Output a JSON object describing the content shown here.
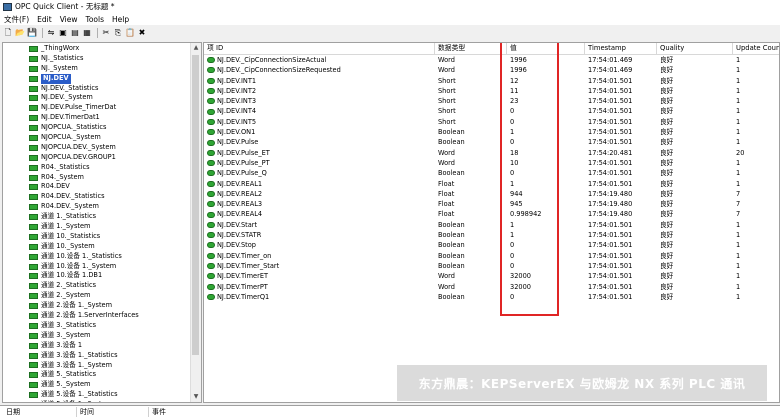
{
  "window": {
    "title": "OPC Quick Client - 无标题 *"
  },
  "menu": [
    "文件(F)",
    "Edit",
    "View",
    "Tools",
    "Help"
  ],
  "toolbar": {
    "icons": [
      "new-file-icon",
      "open-folder-icon",
      "save-icon",
      "add-server-icon",
      "add-group-icon",
      "add-item-icon",
      "properties-icon",
      "cut-icon",
      "copy-icon",
      "paste-icon",
      "delete-icon"
    ],
    "glyphs": [
      "🗋",
      "📂",
      "💾",
      "⇋",
      "▣",
      "▤",
      "▦",
      "✂",
      "⎘",
      "📋",
      "✖"
    ]
  },
  "tree": {
    "items": [
      "_ThingWorx",
      "NJ._Statistics",
      "NJ._System",
      "NJ.DEV",
      "NJ.DEV._Statistics",
      "NJ.DEV._System",
      "NJ.DEV.Pulse_TimerDat",
      "NJ.DEV.TimerDat1",
      "NJOPCUA._Statistics",
      "NJOPCUA._System",
      "NJOPCUA.DEV._System",
      "NJOPCUA.DEV.GROUP1",
      "R04._Statistics",
      "R04._System",
      "R04.DEV",
      "R04.DEV._Statistics",
      "R04.DEV._System",
      "通道 1._Statistics",
      "通道 1._System",
      "通道 10._Statistics",
      "通道 10._System",
      "通道 10.设备 1._Statistics",
      "通道 10.设备 1._System",
      "通道 10.设备 1.DB1",
      "通道 2._Statistics",
      "通道 2._System",
      "通道 2.设备 1._System",
      "通道 2.设备 1.ServerInterfaces",
      "通道 3._Statistics",
      "通道 3._System",
      "通道 3.设备 1",
      "通道 3.设备 1._Statistics",
      "通道 3.设备 1._System",
      "通道 5._Statistics",
      "通道 5._System",
      "通道 5.设备 1._Statistics",
      "通道 5.设备 1._System"
    ],
    "selected": "NJ.DEV"
  },
  "columns": [
    "项 ID",
    "数据类型",
    "值",
    "Timestamp",
    "Quality",
    "Update Count"
  ],
  "rows": [
    [
      "NJ.DEV._CipConnectionSizeActual",
      "Word",
      "1996",
      "17:54:01.469",
      "良好",
      "1"
    ],
    [
      "NJ.DEV._CipConnectionSizeRequested",
      "Word",
      "1996",
      "17:54:01.469",
      "良好",
      "1"
    ],
    [
      "NJ.DEV.INT1",
      "Short",
      "12",
      "17:54:01.501",
      "良好",
      "1"
    ],
    [
      "NJ.DEV.INT2",
      "Short",
      "11",
      "17:54:01.501",
      "良好",
      "1"
    ],
    [
      "NJ.DEV.INT3",
      "Short",
      "23",
      "17:54:01.501",
      "良好",
      "1"
    ],
    [
      "NJ.DEV.INT4",
      "Short",
      "0",
      "17:54:01.501",
      "良好",
      "1"
    ],
    [
      "NJ.DEV.INT5",
      "Short",
      "0",
      "17:54:01.501",
      "良好",
      "1"
    ],
    [
      "NJ.DEV.ON1",
      "Boolean",
      "1",
      "17:54:01.501",
      "良好",
      "1"
    ],
    [
      "NJ.DEV.Pulse",
      "Boolean",
      "0",
      "17:54:01.501",
      "良好",
      "1"
    ],
    [
      "NJ.DEV.Pulse_ET",
      "Word",
      "18",
      "17:54:20.481",
      "良好",
      "20"
    ],
    [
      "NJ.DEV.Pulse_PT",
      "Word",
      "10",
      "17:54:01.501",
      "良好",
      "1"
    ],
    [
      "NJ.DEV.Pulse_Q",
      "Boolean",
      "0",
      "17:54:01.501",
      "良好",
      "1"
    ],
    [
      "NJ.DEV.REAL1",
      "Float",
      "1",
      "17:54:01.501",
      "良好",
      "1"
    ],
    [
      "NJ.DEV.REAL2",
      "Float",
      "944",
      "17:54:19.480",
      "良好",
      "7"
    ],
    [
      "NJ.DEV.REAL3",
      "Float",
      "945",
      "17:54:19.480",
      "良好",
      "7"
    ],
    [
      "NJ.DEV.REAL4",
      "Float",
      "0.998942",
      "17:54:19.480",
      "良好",
      "7"
    ],
    [
      "NJ.DEV.Start",
      "Boolean",
      "1",
      "17:54:01.501",
      "良好",
      "1"
    ],
    [
      "NJ.DEV.STATR",
      "Boolean",
      "1",
      "17:54:01.501",
      "良好",
      "1"
    ],
    [
      "NJ.DEV.Stop",
      "Boolean",
      "0",
      "17:54:01.501",
      "良好",
      "1"
    ],
    [
      "NJ.DEV.Timer_on",
      "Boolean",
      "0",
      "17:54:01.501",
      "良好",
      "1"
    ],
    [
      "NJ.DEV.Timer_Start",
      "Boolean",
      "0",
      "17:54:01.501",
      "良好",
      "1"
    ],
    [
      "NJ.DEV.TimerET",
      "Word",
      "32000",
      "17:54:01.501",
      "良好",
      "1"
    ],
    [
      "NJ.DEV.TimerPT",
      "Word",
      "32000",
      "17:54:01.501",
      "良好",
      "1"
    ],
    [
      "NJ.DEV.TimerQ1",
      "Boolean",
      "0",
      "17:54:01.501",
      "良好",
      "1"
    ]
  ],
  "watermark": "东方鼎晨：KEPServerEX 与欧姆龙 NX 系列 PLC 通讯",
  "event_log": {
    "columns": [
      "日期",
      "时间",
      "事件"
    ]
  },
  "colors": {
    "highlight": "#e02525",
    "selected": "#2a5cc8",
    "folder": "#2fa534"
  }
}
